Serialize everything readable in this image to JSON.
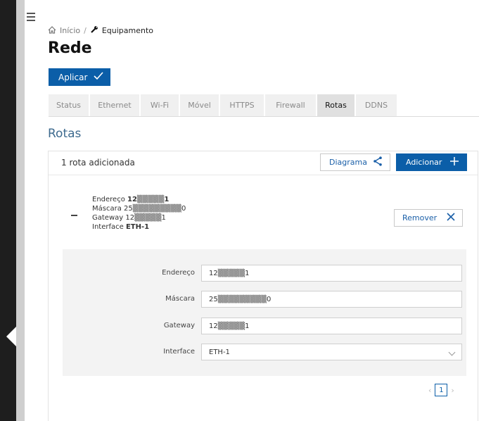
{
  "breadcrumb": {
    "home": "Início",
    "separator": "/",
    "current": "Equipamento"
  },
  "page_title": "Rede",
  "apply_label": "Aplicar",
  "tabs": [
    {
      "label": "Status"
    },
    {
      "label": "Ethernet"
    },
    {
      "label": "Wi-Fi"
    },
    {
      "label": "Móvel"
    },
    {
      "label": "HTTPS"
    },
    {
      "label": "Firewall"
    },
    {
      "label": "Rotas",
      "active": true
    },
    {
      "label": "DDNS"
    }
  ],
  "section_title": "Rotas",
  "card": {
    "count_text": "1 rota adicionada",
    "diagram_label": "Diagrama",
    "add_label": "Adicionar"
  },
  "route_summary": {
    "address_label": "Endereço",
    "address_value": "12▒▒▒▒▒1",
    "mask_label": "Máscara",
    "mask_value": "25▒▒▒▒▒▒▒▒▒0",
    "gateway_label": "Gateway",
    "gateway_value": "12▒▒▒▒▒1",
    "interface_label": "Interface",
    "interface_value": "ETH-1",
    "remove_label": "Remover"
  },
  "route_form": {
    "address_label": "Endereço",
    "address_value": "12▒▒▒▒▒1",
    "mask_label": "Máscara",
    "mask_value": "25▒▒▒▒▒▒▒▒▒0",
    "gateway_label": "Gateway",
    "gateway_value": "12▒▒▒▒▒1",
    "interface_label": "Interface",
    "interface_value": "ETH-1"
  },
  "pagination": {
    "current_page": "1",
    "prev": "‹",
    "next": "›"
  },
  "icons": {
    "menu": "menu-icon",
    "home": "home-icon",
    "wrench": "wrench-icon",
    "check": "check-icon",
    "share": "share-icon",
    "plus": "plus-icon",
    "close": "close-icon",
    "chevron": "chevron-down-icon"
  },
  "colors": {
    "accent": "#0b5ea8",
    "section_title": "#3d6a8e"
  }
}
